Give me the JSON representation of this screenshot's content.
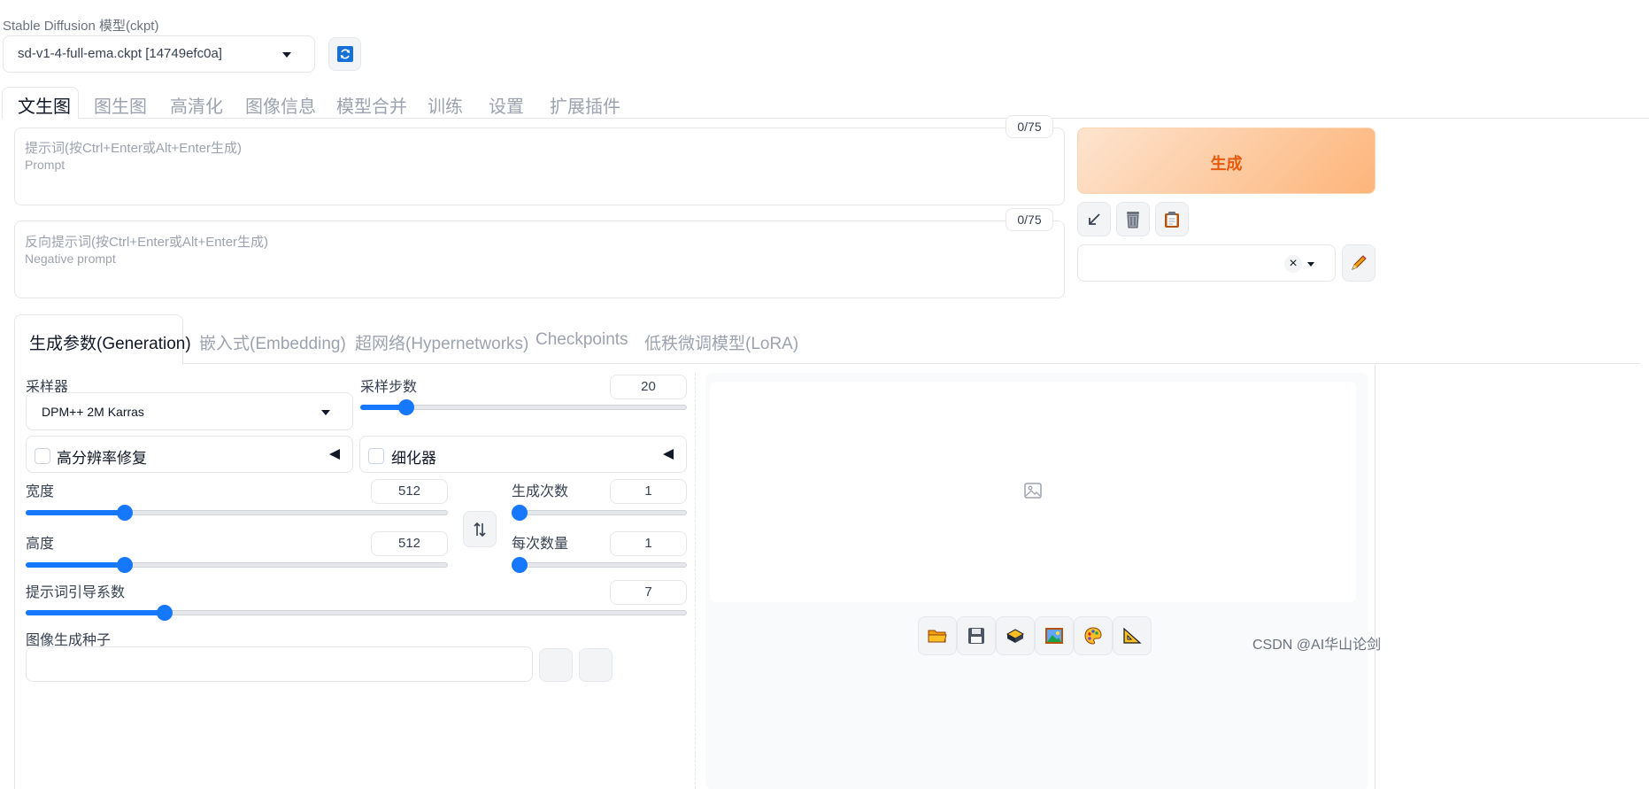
{
  "checkpoint": {
    "label": "Stable Diffusion 模型(ckpt)",
    "selected": "sd-v1-4-full-ema.ckpt [14749efc0a]"
  },
  "main_tabs": [
    "文生图",
    "图生图",
    "高清化",
    "图像信息",
    "模型合并",
    "训练",
    "设置",
    "扩展插件"
  ],
  "prompt": {
    "placeholder_line1": "提示词(按Ctrl+Enter或Alt+Enter生成)",
    "placeholder_line2": "Prompt",
    "counter": "0/75"
  },
  "negative_prompt": {
    "placeholder_line1": "反向提示词(按Ctrl+Enter或Alt+Enter生成)",
    "placeholder_line2": "Negative prompt",
    "counter": "0/75"
  },
  "generate_button": "生成",
  "style_select": {
    "value": ""
  },
  "sub_tabs": [
    "生成参数(Generation)",
    "嵌入式(Embedding)",
    "超网络(Hypernetworks)",
    "Checkpoints",
    "低秩微调模型(LoRA)"
  ],
  "params": {
    "sampler": {
      "label": "采样器",
      "value": "DPM++ 2M Karras"
    },
    "steps": {
      "label": "采样步数",
      "value": "20",
      "fraction": 0.14
    },
    "hires_fix": {
      "label": "高分辨率修复"
    },
    "refiner": {
      "label": "细化器"
    },
    "width": {
      "label": "宽度",
      "value": "512",
      "fraction": 0.235
    },
    "height": {
      "label": "高度",
      "value": "512",
      "fraction": 0.235
    },
    "batch_count": {
      "label": "生成次数",
      "value": "1",
      "fraction": 0.0
    },
    "batch_size": {
      "label": "每次数量",
      "value": "1",
      "fraction": 0.0
    },
    "cfg_scale": {
      "label": "提示词引导系数",
      "value": "7",
      "fraction": 0.21
    },
    "seed": {
      "label": "图像生成种子"
    }
  },
  "watermark": "CSDN @AI华山论剑",
  "icons": {
    "refresh": "refresh-icon",
    "swap": "swap-icon",
    "image_placeholder": "image-icon"
  },
  "colors": {
    "accent": "#1677ff",
    "generate_text": "#ea580c",
    "generate_bg_start": "#fde4cf",
    "generate_bg_end": "#fdb57a"
  }
}
